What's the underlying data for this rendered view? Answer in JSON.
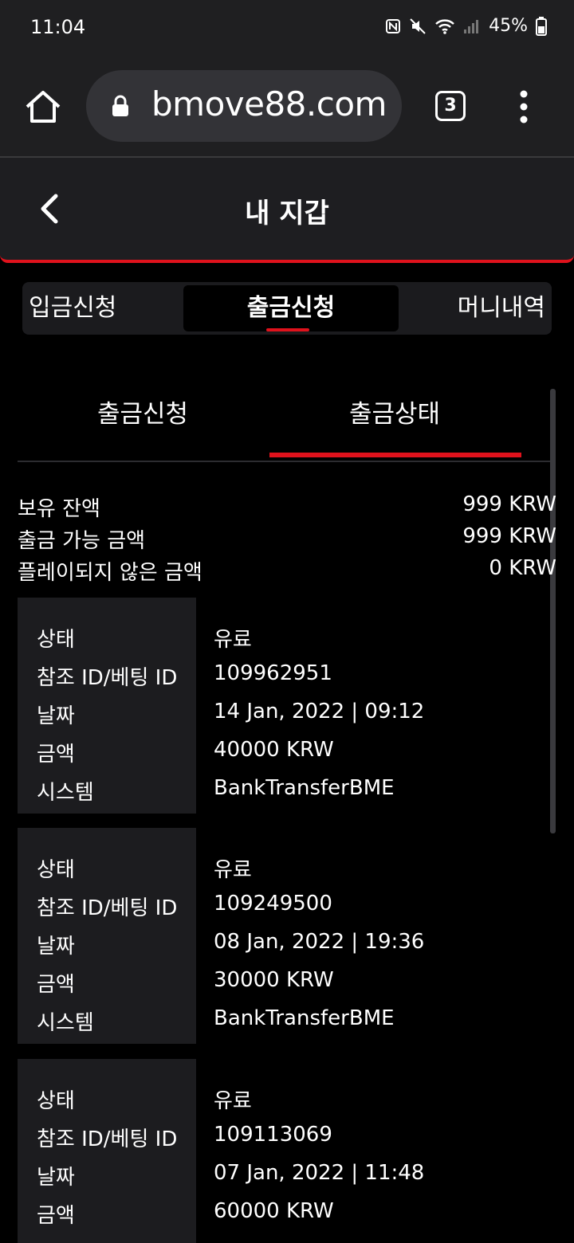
{
  "status": {
    "time": "11:04",
    "battery": "45%"
  },
  "browser": {
    "url": "bmove88.com",
    "tab_count": "3"
  },
  "header": {
    "title": "내 지갑"
  },
  "main_tabs": [
    {
      "label": "입금신청"
    },
    {
      "label": "출금신청"
    },
    {
      "label": "머니내역"
    }
  ],
  "sub_tabs": [
    {
      "label": "출금신청"
    },
    {
      "label": "출금상태"
    }
  ],
  "summary": [
    {
      "label": "보유 잔액",
      "value": "999 KRW"
    },
    {
      "label": "출금 가능 금액",
      "value": "999 KRW"
    },
    {
      "label": "플레이되지 않은 금액",
      "value": "0 KRW"
    }
  ],
  "field_labels": {
    "status": "상태",
    "ref_id": "참조 ID/베팅 ID",
    "date": "날짜",
    "amount": "금액",
    "system": "시스템"
  },
  "records": [
    {
      "status": "유료",
      "ref_id": "109962951",
      "date": "14 Jan, 2022 | 09:12",
      "amount": "40000 KRW",
      "system": "BankTransferBME"
    },
    {
      "status": "유료",
      "ref_id": "109249500",
      "date": "08 Jan, 2022 | 19:36",
      "amount": "30000 KRW",
      "system": "BankTransferBME"
    },
    {
      "status": "유료",
      "ref_id": "109113069",
      "date": "07 Jan, 2022 | 11:48",
      "amount": "60000 KRW",
      "system": ""
    }
  ],
  "colors": {
    "accent": "#e0121c",
    "panel": "#1c1c1f",
    "background": "#000000"
  }
}
